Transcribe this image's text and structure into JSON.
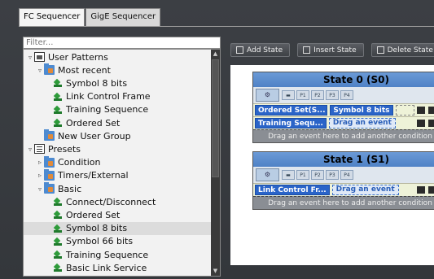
{
  "tabs": [
    {
      "label": "FC Sequencer",
      "active": true
    },
    {
      "label": "GigE Sequencer",
      "active": false
    }
  ],
  "filter": {
    "placeholder": "Filter..."
  },
  "tree": [
    {
      "label": "User Patterns",
      "level": 0,
      "twist": "▿",
      "icon": "box-icon"
    },
    {
      "label": "Most recent",
      "level": 1,
      "twist": "▿",
      "icon": "folder-icon"
    },
    {
      "label": "Symbol 8 bits",
      "level": 2,
      "twist": "",
      "icon": "leaf-icon"
    },
    {
      "label": "Link Control Frame",
      "level": 2,
      "twist": "",
      "icon": "leaf-icon"
    },
    {
      "label": "Training Sequence",
      "level": 2,
      "twist": "",
      "icon": "leaf-icon"
    },
    {
      "label": "Ordered Set",
      "level": 2,
      "twist": "",
      "icon": "leaf-icon"
    },
    {
      "label": "New User Group",
      "level": 1,
      "twist": "",
      "icon": "folder-icon"
    },
    {
      "label": "Presets",
      "level": 0,
      "twist": "▿",
      "icon": "list-icon"
    },
    {
      "label": "Condition",
      "level": 1,
      "twist": "▹",
      "icon": "folder-icon"
    },
    {
      "label": "Timers/External",
      "level": 1,
      "twist": "▹",
      "icon": "folder-icon"
    },
    {
      "label": "Basic",
      "level": 1,
      "twist": "▿",
      "icon": "folder-icon"
    },
    {
      "label": "Connect/Disconnect",
      "level": 2,
      "twist": "",
      "icon": "leaf-icon"
    },
    {
      "label": "Ordered Set",
      "level": 2,
      "twist": "",
      "icon": "leaf-icon"
    },
    {
      "label": "Symbol 8 bits",
      "level": 2,
      "twist": "",
      "icon": "leaf-icon",
      "selected": true
    },
    {
      "label": "Symbol 66 bits",
      "level": 2,
      "twist": "",
      "icon": "leaf-icon"
    },
    {
      "label": "Training Sequence",
      "level": 2,
      "twist": "",
      "icon": "leaf-icon"
    },
    {
      "label": "Basic Link Service",
      "level": 2,
      "twist": "",
      "icon": "leaf-icon"
    }
  ],
  "toolbar": {
    "add_state": "Add State",
    "insert_state": "Insert State",
    "delete_state": "Delete State"
  },
  "states": [
    {
      "title": "State 0 (S0)",
      "icon_labels": [
        "P1",
        "P2",
        "P3",
        "P4"
      ],
      "events": [
        {
          "label": "Ordered Set(S...",
          "value": "Symbol 8 bits",
          "drag": ""
        },
        {
          "label": "Training Sequ...",
          "value": "",
          "drag": "Drag an event"
        }
      ],
      "condition_hint": "Drag an event here to add another condition"
    },
    {
      "title": "State 1 (S1)",
      "icon_labels": [
        "P1",
        "P2",
        "P3",
        "P4"
      ],
      "events": [
        {
          "label": "Link Control Fr...",
          "value": "",
          "drag": "Drag an event"
        }
      ],
      "condition_hint": "Drag an event here to add another condition"
    }
  ]
}
